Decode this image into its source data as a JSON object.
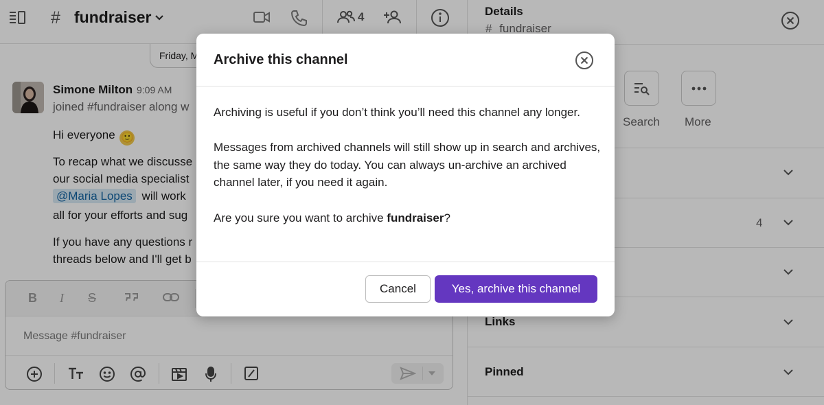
{
  "header": {
    "hash": "#",
    "channel_name": "fundraiser",
    "member_count": "4"
  },
  "conversation": {
    "date_label": "Friday, M",
    "author": "Simone Milton",
    "time": "9:09 AM",
    "joined_text": "joined #fundraiser along w",
    "greeting": "Hi everyone",
    "greeting_emoji": "🙂",
    "recap_line1": "To recap what we discusse",
    "recap_line2": "our social media specialist",
    "mention": "@Maria Lopes",
    "recap_line3_rest": "will work",
    "recap_line4": "all for your efforts and sug",
    "q_line1": "If you have any questions r",
    "q_line2": "threads below and I'll get b"
  },
  "composer": {
    "placeholder": "Message #fundraiser",
    "format_labels": {
      "bold": "B",
      "italic": "I",
      "strike": "S"
    }
  },
  "details": {
    "title": "Details",
    "hash": "#",
    "channel": "fundraiser",
    "actions": [
      {
        "label": "Search",
        "icon": "search-icon"
      },
      {
        "label": "More",
        "icon": "more-icon"
      }
    ],
    "members_count": "4",
    "sections": {
      "links": "Links",
      "pinned": "Pinned"
    }
  },
  "modal": {
    "title": "Archive this channel",
    "para1": "Archiving is useful if you don’t think you’ll need this channel any longer.",
    "para2": "Messages from archived channels will still show up in search and archives, the same way they do today. You can always un-archive an archived channel later, if you need it again.",
    "confirm_prefix": "Are you sure you want to archive ",
    "confirm_channel": "fundraiser",
    "confirm_suffix": "?",
    "cancel_label": "Cancel",
    "confirm_label": "Yes, archive this channel"
  },
  "colors": {
    "primary_button": "#6437c0",
    "mention_bg": "#d7e9f4",
    "overlay": "rgba(0,0,0,0.28)"
  }
}
